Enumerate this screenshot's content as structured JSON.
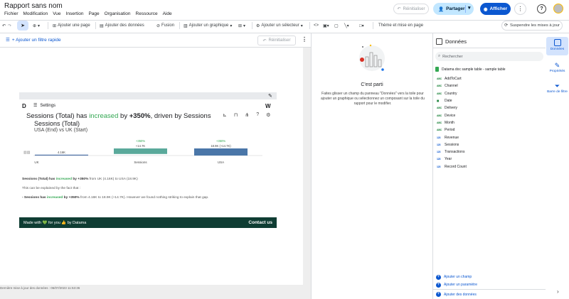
{
  "app": {
    "title": "Rapport sans nom"
  },
  "menus": [
    "Fichier",
    "Modification",
    "Vue",
    "Insertion",
    "Page",
    "Organisation",
    "Ressource",
    "Aide"
  ],
  "header": {
    "reset_label": "Réinitialiser",
    "share_label": "Partager",
    "view_label": "Afficher",
    "more": "⋮",
    "help": "?"
  },
  "toolbar": {
    "add_page": "Ajouter une page",
    "add_data": "Ajouter des données",
    "blend": "Fusion",
    "add_chart": "Ajouter un graphique",
    "add_control": "Ajouter un sélecteur",
    "theme": "Thème et mise en page",
    "suspend": "Suspendre les mises à jour"
  },
  "filterbar": {
    "add_filter": "+ Ajouter un filtre rapide",
    "reset": "Réinitialiser"
  },
  "widget": {
    "settings": "Settings",
    "headline_a": "Sessions (Total) has ",
    "headline_b": "increased",
    "headline_c": " by ",
    "headline_d": "+350%",
    "headline_e": ", driven by Sessions",
    "sub1": "Sessions (Total)",
    "sub2": "USA (End) vs UK (Start)",
    "p1a": "Sessions (Total) has ",
    "p1b": "increased",
    "p1c": " by +350%",
    "p1d": " from UK (4.16K) to USA (18.9K)",
    "p2": "This can be explained by the fact that :",
    "p3a": "- Sessions has ",
    "p3b": "increased",
    "p3c": " by +350%",
    "p3d": " from 4.16K to 18.9K (+14.7K). However we found nothing striking to explain that gap.",
    "footer_left": "Made with 💚 for you 👍 by Datama",
    "footer_right": "Contact us"
  },
  "chart_data": {
    "type": "bar",
    "categories": [
      "UK",
      "Sessions",
      "USA"
    ],
    "values": [
      4.16,
      14.7,
      18.9
    ],
    "data_labels": [
      "4.16K",
      "+14.7K",
      "18.9K (+14.7K)"
    ],
    "top_labels": [
      "",
      "+350%",
      "+350%"
    ],
    "colors": [
      "#4a6fa5",
      "#5aa99b",
      "#4a76a8"
    ],
    "title": "",
    "xlabel": "",
    "ylabel": ""
  },
  "last_update": "Dernière mise à jour des données : 06/07/2023 11:53:36",
  "mid": {
    "title": "C'est parti",
    "desc": "Faites glisser un champ du panneau \"Données\" vers la toile pour ajouter un graphique ou sélectionnez un composant sur la toile du rapport pour le modifier."
  },
  "data_panel": {
    "title": "Données",
    "search_placeholder": "Rechercher",
    "source": "Datama doc sample table - sample table",
    "fields": [
      {
        "type": "ABC",
        "name": "AddToCart"
      },
      {
        "type": "ABC",
        "name": "Channel"
      },
      {
        "type": "ABC",
        "name": "Country"
      },
      {
        "type": "date",
        "name": "Date"
      },
      {
        "type": "ABC",
        "name": "Delivery"
      },
      {
        "type": "ABC",
        "name": "Device"
      },
      {
        "type": "ABC",
        "name": "Month"
      },
      {
        "type": "ABC",
        "name": "Period"
      },
      {
        "type": "123",
        "name": "Revenue"
      },
      {
        "type": "123",
        "name": "Sessions"
      },
      {
        "type": "123",
        "name": "Transactions"
      },
      {
        "type": "123",
        "name": "Year"
      },
      {
        "type": "123",
        "name": "Record Count"
      }
    ],
    "add_field": "Ajouter un champ",
    "add_param": "Ajouter un paramètre",
    "add_data": "Ajouter des données"
  },
  "sidebar": {
    "data": "Données",
    "props": "Propriétés",
    "bar": "Barre de filtre"
  }
}
